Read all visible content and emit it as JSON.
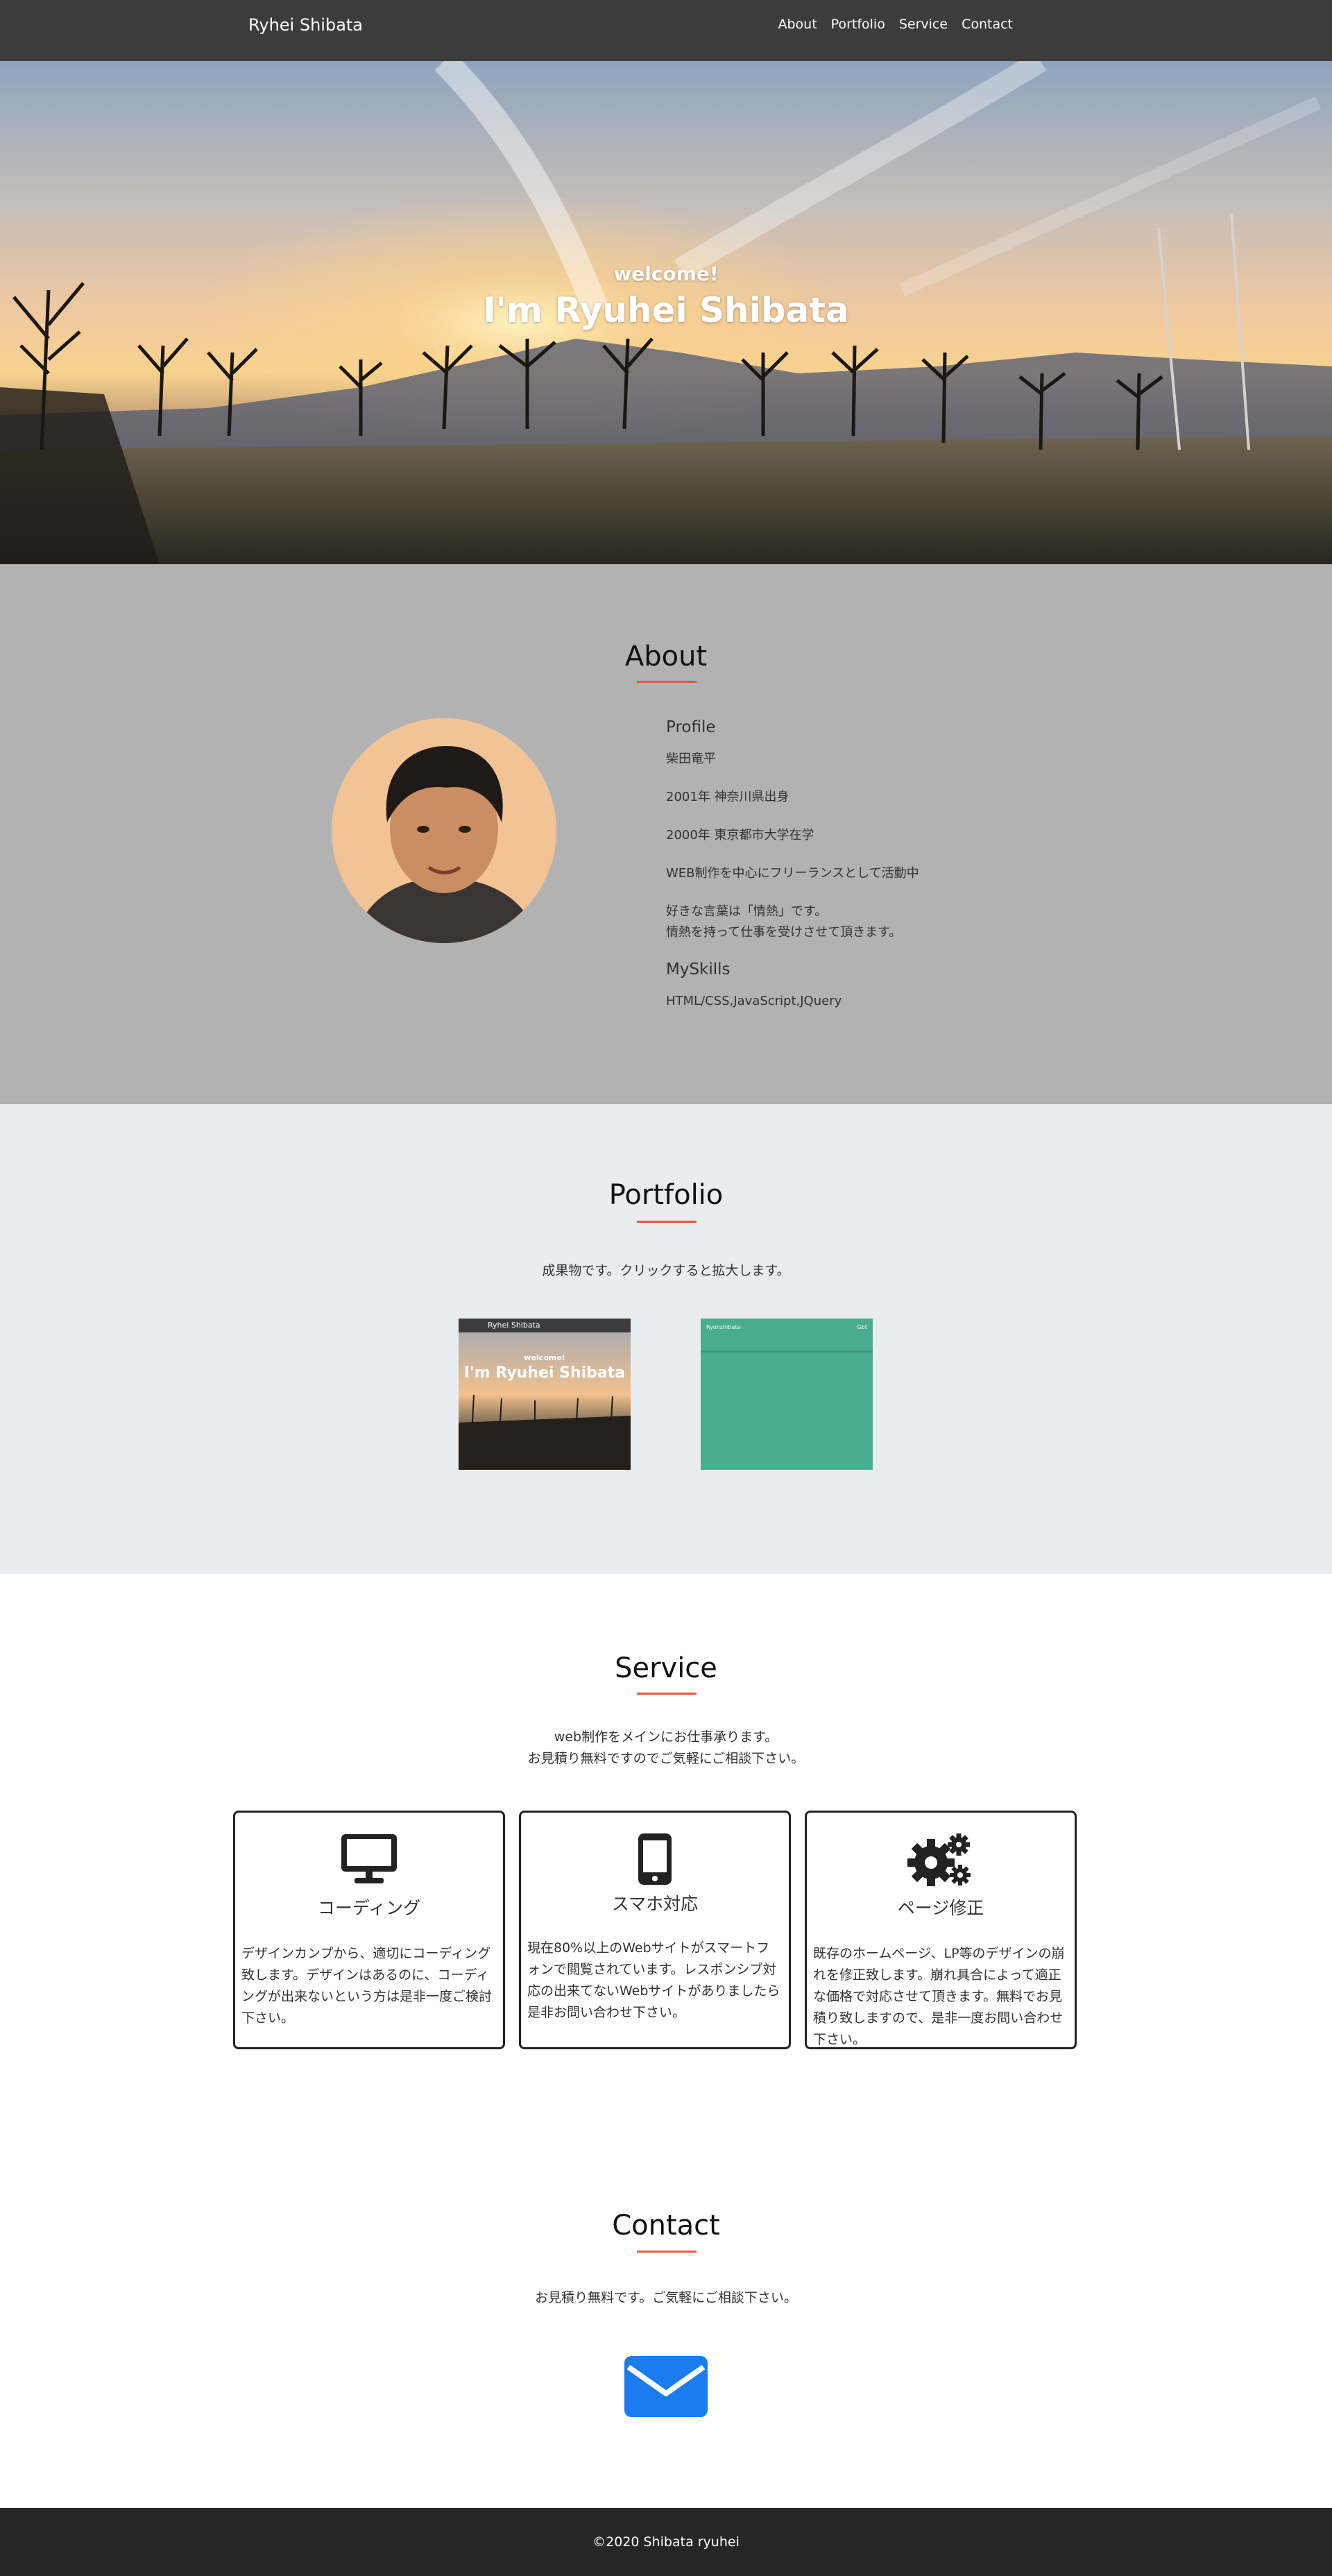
{
  "header": {
    "brand": "Ryhei Shibata",
    "nav": [
      "About",
      "Portfolio",
      "Service",
      "Contact"
    ]
  },
  "hero": {
    "welcome": "welcome!",
    "name": "I'm Ryuhei Shibata"
  },
  "about": {
    "title": "About",
    "profile_heading": "Profile",
    "profile": [
      "柴田竜平",
      "2001年 神奈川県出身",
      "2000年 東京都市大学在学",
      "WEB制作を中心にフリーランスとして活動中",
      "好きな言葉は「情熱」です。",
      "情熱を持って仕事を受けさせて頂きます。"
    ],
    "skills_heading": "MySkills",
    "skills": "HTML/CSS,JavaScript,JQuery"
  },
  "portfolio": {
    "title": "Portfolio",
    "lead": "成果物です。クリックすると拡大します。",
    "thumb1": {
      "brand": "Ryhei Shibata",
      "welcome": "welcome!",
      "name": "I'm Ryuhei Shibata"
    },
    "thumb2": {
      "brand": "Ryohshibata",
      "nav": "Gbt"
    }
  },
  "service": {
    "title": "Service",
    "lead_line1": "web制作をメインにお仕事承ります。",
    "lead_line2": "お見積り無料ですのでご気軽にご相談下さい。",
    "cards": [
      {
        "icon": "monitor-icon",
        "title": "コーディング",
        "desc": "デザインカンプから、適切にコーディング致します。デザインはあるのに、コーディングが出来ないという方は是非一度ご検討下さい。"
      },
      {
        "icon": "smartphone-icon",
        "title": "スマホ対応",
        "desc": "現在80%以上のWebサイトがスマートフォンで閲覧されています。レスポンシブ対応の出来てないWebサイトがありましたら是非お問い合わせ下さい。"
      },
      {
        "icon": "gears-icon",
        "title": "ページ修正",
        "desc": "既存のホームページ、LP等のデザインの崩れを修正致します。崩れ具合によって適正な価格で対応させて頂きます。無料でお見積り致しますので、是非一度お問い合わせ下さい。"
      }
    ]
  },
  "contact": {
    "title": "Contact",
    "lead": "お見積り無料です。ご気軽にご相談下さい。",
    "icon": "envelope-icon"
  },
  "footer": {
    "copyright": "©2020 Shibata ryuhei"
  },
  "colors": {
    "accent": "#e8573f",
    "mail_blue": "#1a7cf0",
    "about_bg": "#b2b2b2",
    "portfolio_bg": "#eaedf0"
  }
}
